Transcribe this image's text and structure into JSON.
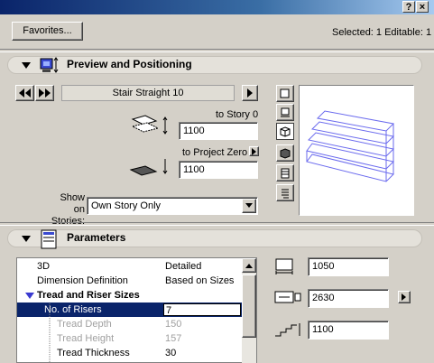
{
  "titlebar": {
    "help_label": "?",
    "close_label": "×"
  },
  "header": {
    "favorites_label": "Favorites...",
    "selection_status": "Selected: 1 Editable: 1"
  },
  "preview": {
    "title": "Preview and Positioning",
    "element_name": "Stair Straight 10",
    "to_story_label": "to Story 0",
    "to_story_value": "1100",
    "to_project_zero_label": "to Project Zero",
    "project_zero_value": "1100",
    "show_on_stories_label": "Show on Stories:",
    "show_on_stories_value": "Own Story Only"
  },
  "parameters": {
    "title": "Parameters",
    "rows": [
      {
        "label": "3D",
        "value": "Detailed",
        "kind": "normal"
      },
      {
        "label": "Dimension Definition",
        "value": "Based on Sizes",
        "kind": "normal"
      },
      {
        "label": "Tread and Riser Sizes",
        "value": "",
        "kind": "group"
      },
      {
        "label": "No. of Risers",
        "value": "7",
        "kind": "selected"
      },
      {
        "label": "Tread Depth",
        "value": "150",
        "kind": "disabled"
      },
      {
        "label": "Tread Height",
        "value": "157",
        "kind": "disabled"
      },
      {
        "label": "Tread Thickness",
        "value": "30",
        "kind": "child"
      }
    ],
    "width_value": "1050",
    "length_value": "2630",
    "height_value": "1100"
  },
  "colors": {
    "selection": "#0a246a",
    "title_start": "#0a246a",
    "preview_lines": "#6a6aee"
  }
}
